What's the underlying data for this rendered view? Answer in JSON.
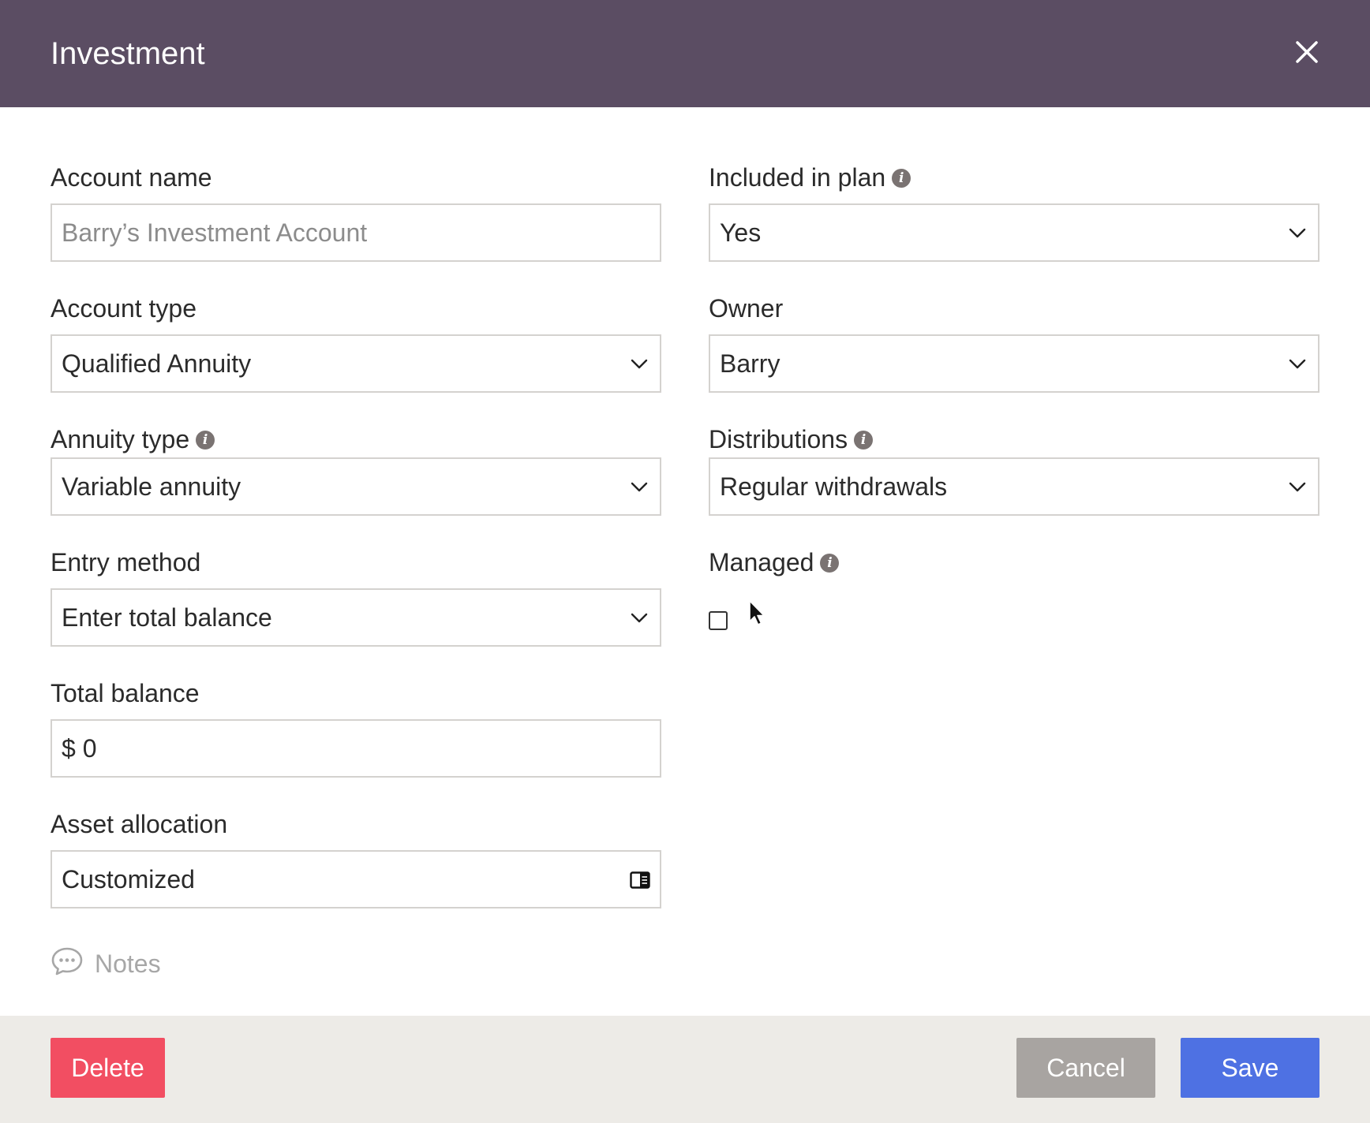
{
  "header": {
    "title": "Investment",
    "close_icon": "close-icon"
  },
  "left": {
    "account_name": {
      "label": "Account name",
      "placeholder": "Barry’s Investment Account"
    },
    "account_type": {
      "label": "Account type",
      "value": "Qualified Annuity"
    },
    "annuity_type": {
      "label": "Annuity type",
      "value": "Variable annuity"
    },
    "entry_method": {
      "label": "Entry method",
      "value": "Enter total balance"
    },
    "total_balance": {
      "label": "Total balance",
      "value": "$ 0"
    },
    "asset_allocation": {
      "label": "Asset allocation",
      "value": "Customized"
    }
  },
  "right": {
    "included_in_plan": {
      "label": "Included in plan",
      "value": "Yes"
    },
    "owner": {
      "label": "Owner",
      "value": "Barry"
    },
    "distributions": {
      "label": "Distributions",
      "value": "Regular withdrawals"
    },
    "managed": {
      "label": "Managed",
      "checked": false
    }
  },
  "notes": {
    "label": "Notes"
  },
  "footer": {
    "delete_label": "Delete",
    "cancel_label": "Cancel",
    "save_label": "Save"
  },
  "colors": {
    "header_bg": "#5b4d63",
    "delete": "#f24e62",
    "cancel": "#a8a4a1",
    "save": "#4e71e3",
    "footer_bg": "#edebe7"
  }
}
